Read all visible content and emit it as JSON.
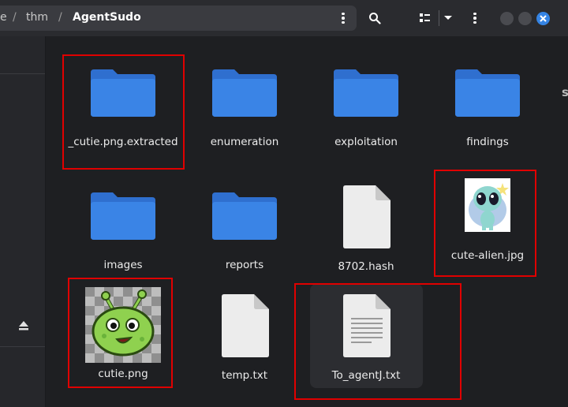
{
  "breadcrumb": {
    "partial": "e",
    "sep1": "/",
    "parent": "thm",
    "sep2": "/",
    "current": "AgentSudo"
  },
  "toolbar": {
    "path_menu": "kebab-menu-icon",
    "search": "search-icon",
    "view_toggle": "list-view-icon",
    "view_dropdown": "chevron-down-icon",
    "main_menu": "kebab-menu-icon"
  },
  "files": [
    {
      "name": "_cutie.png.extracted",
      "type": "folder"
    },
    {
      "name": "enumeration",
      "type": "folder"
    },
    {
      "name": "exploitation",
      "type": "folder"
    },
    {
      "name": "findings",
      "type": "folder"
    },
    {
      "name": "images",
      "type": "folder"
    },
    {
      "name": "reports",
      "type": "folder"
    },
    {
      "name": "8702.hash",
      "type": "file"
    },
    {
      "name": "cute-alien.jpg",
      "type": "image"
    },
    {
      "name": "cutie.png",
      "type": "image"
    },
    {
      "name": "temp.txt",
      "type": "file"
    },
    {
      "name": "To_agentJ.txt",
      "type": "text"
    }
  ],
  "colors": {
    "folder": "#3a7fe0",
    "highlight": "#e00000",
    "accent": "#3584e4"
  }
}
